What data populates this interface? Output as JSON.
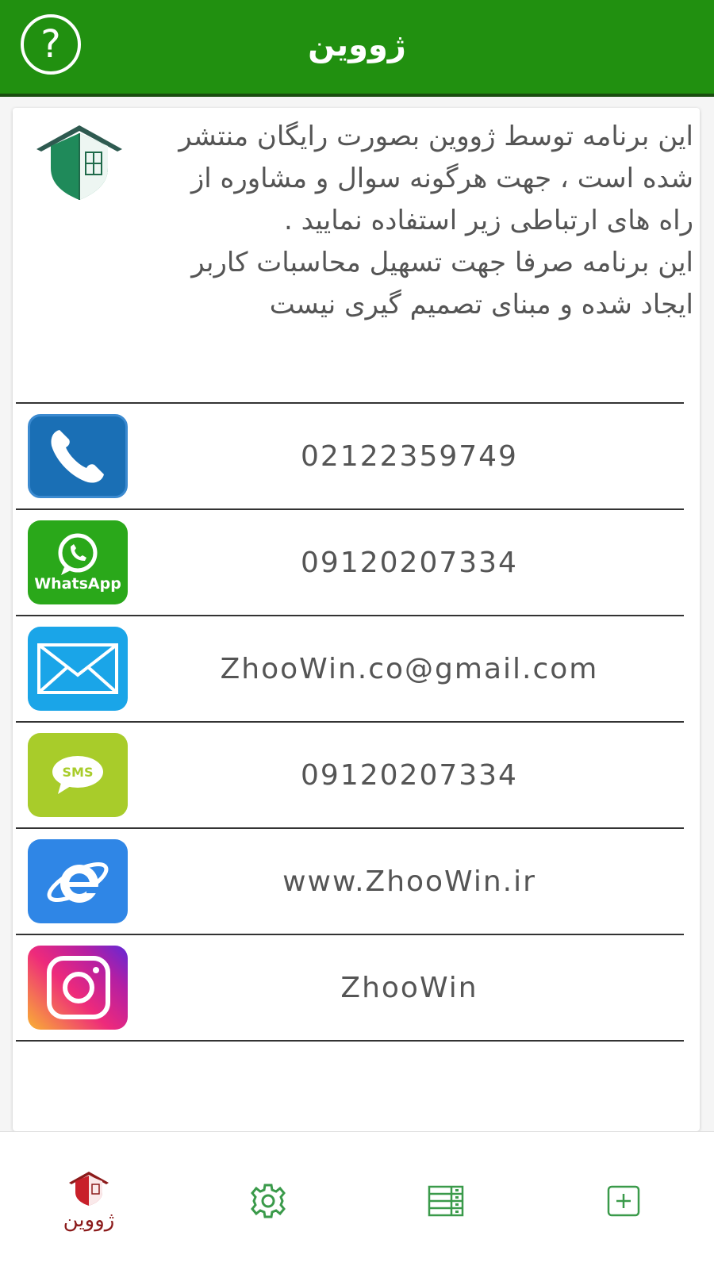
{
  "header": {
    "title": "ژووین",
    "help_icon": "?"
  },
  "intro": {
    "paragraph1": "این برنامه توسط ژووین بصورت رایگان منتشر شده است ، جهت هرگونه سوال و مشاوره از راه های ارتباطی زیر استفاده نمایید .",
    "paragraph2": "این برنامه صرفا جهت تسهیل محاسبات کاربر ایجاد شده و مبنای تصمیم گیری نیست"
  },
  "contacts": [
    {
      "icon": "phone-icon",
      "value": "02122359749"
    },
    {
      "icon": "whatsapp-icon",
      "label": "WhatsApp",
      "value": "09120207334"
    },
    {
      "icon": "email-icon",
      "value": "ZhooWin.co@gmail.com"
    },
    {
      "icon": "sms-icon",
      "label": "SMS",
      "value": "09120207334"
    },
    {
      "icon": "internet-explorer-icon",
      "value": "www.ZhooWin.ir"
    },
    {
      "icon": "instagram-icon",
      "value": "ZhooWin"
    }
  ],
  "nav": {
    "home_label": "ژووین",
    "items": [
      "home-logo-icon",
      "gear-icon",
      "table-icon",
      "add-icon"
    ]
  },
  "colors": {
    "header_green": "#219010",
    "phone_blue": "#1a6fb5",
    "whatsapp_green": "#2aa81a",
    "email_blue": "#1aa5e8",
    "sms_green": "#a8cc2a",
    "ie_blue": "#2f86e6",
    "nav_icon_green": "#3a9a4a",
    "nav_label_red": "#8b1a1a"
  }
}
